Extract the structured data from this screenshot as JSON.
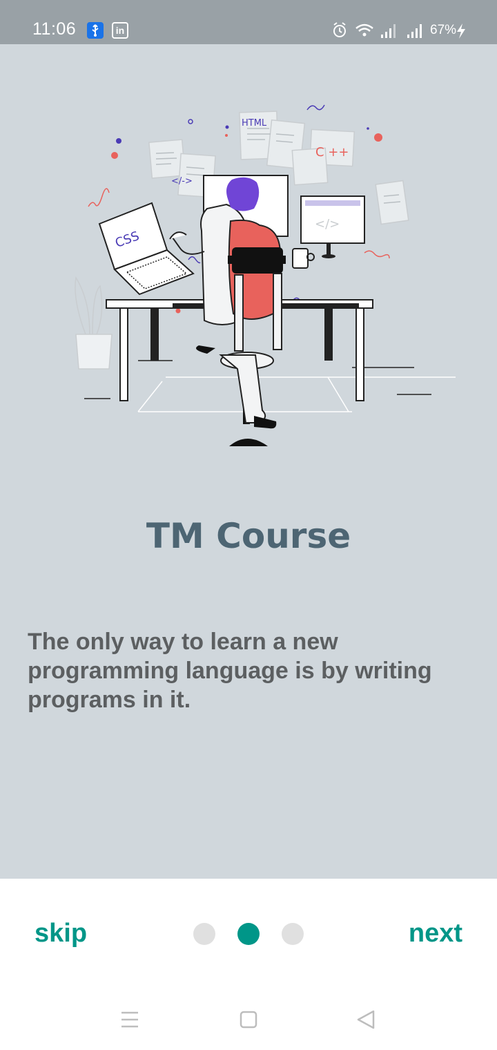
{
  "status_bar": {
    "time": "11:06",
    "battery": "67%",
    "linkedin_label": "in",
    "icons": [
      "usb-icon",
      "linkedin-icon",
      "alarm-icon",
      "wifi-icon",
      "signal-icon",
      "signal-icon",
      "charging-icon"
    ]
  },
  "illustration": {
    "labels": [
      "HTML",
      "C ++",
      "CSS",
      "</->",
      "</>"
    ]
  },
  "content": {
    "title": "TM Course",
    "description": "The only way to learn a new programming language is by writing programs in it."
  },
  "onboarding": {
    "skip_label": "skip",
    "next_label": "next",
    "page_count": 3,
    "active_page": 2
  },
  "system_nav": {
    "icons": [
      "menu-icon",
      "home-icon",
      "back-icon"
    ]
  },
  "colors": {
    "accent": "#009688",
    "background": "#d0d7dc",
    "title": "#4d6573",
    "status_bar": "#99a1a6"
  }
}
